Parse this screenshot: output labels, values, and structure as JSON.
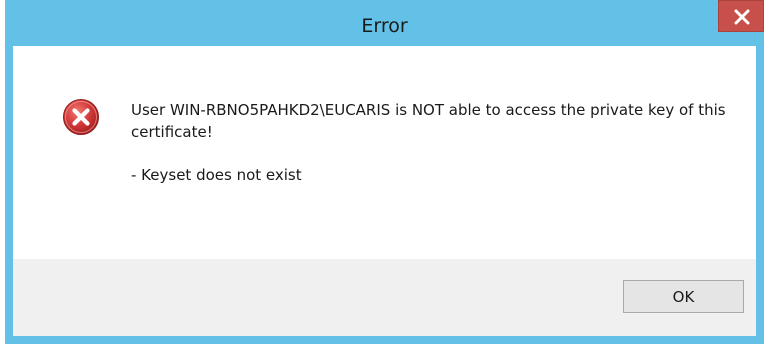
{
  "window": {
    "title": "Error",
    "close_label": "x"
  },
  "dialog": {
    "icon": "error-icon",
    "message_line": "User WIN-RBNO5PAHKD2\\EUCARIS is NOT able to access the private key of this certificate!",
    "detail_line": "- Keyset does not exist"
  },
  "buttons": {
    "ok_label": "OK"
  },
  "colors": {
    "title_bar": "#63c0e6",
    "close_button": "#c7504b",
    "error_icon": "#d43b3b",
    "footer": "#f0f0f0"
  }
}
